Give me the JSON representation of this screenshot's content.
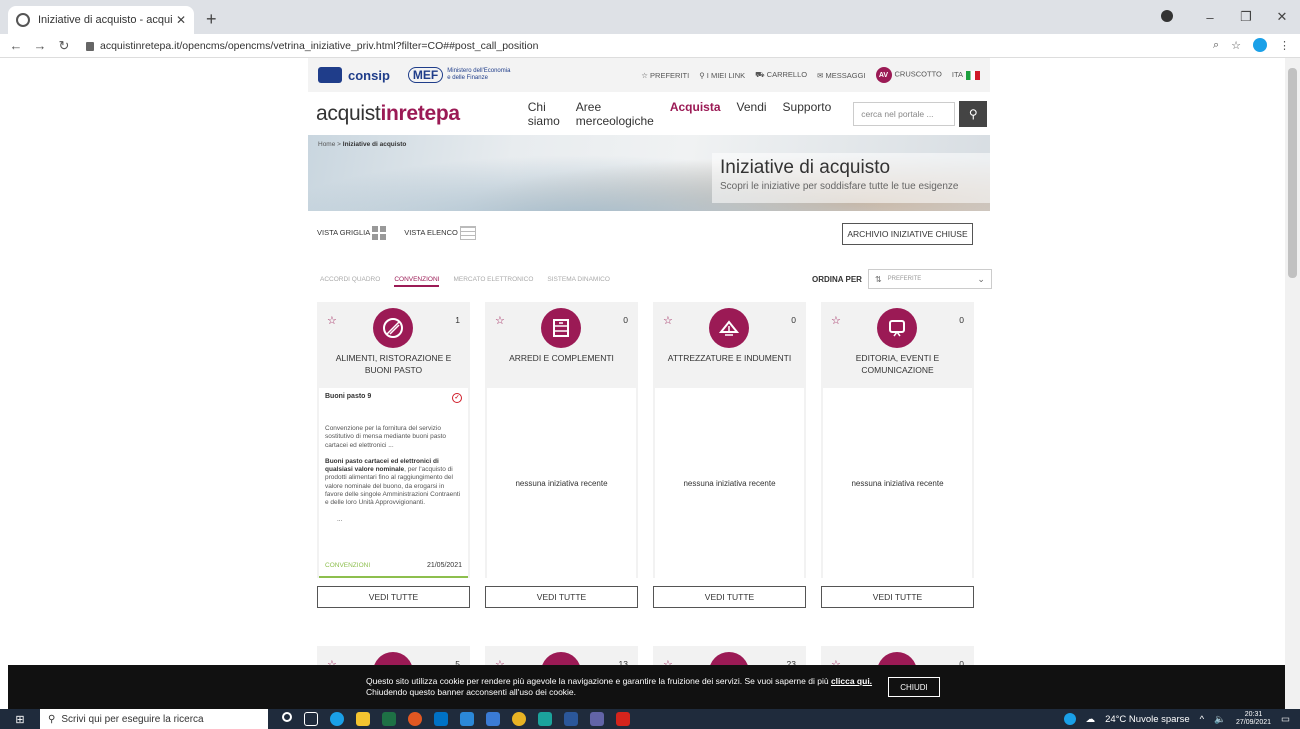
{
  "browser": {
    "tab_title": "Iniziative di acquisto - acquistinr",
    "tab_close": "✕",
    "new_tab": "+",
    "url": "acquistinretepa.it/opencms/opencms/vetrina_iniziative_priv.html?filter=CO##post_call_position",
    "window_min": "–",
    "window_max": "❐",
    "window_close": "✕"
  },
  "topstrip": {
    "consip": "consip",
    "mef": "MEF",
    "mef_sub": "Ministero dell'Economia e delle Finanze",
    "links": [
      "PREFERITI",
      "I MIEI LINK",
      "CARRELLO",
      "MESSAGGI"
    ],
    "avatar": "AV",
    "cruscotto": "CRUSCOTTO",
    "lang": "ITA"
  },
  "header": {
    "brand_a": "acquist",
    "brand_b": "inrete",
    "brand_c": "pa",
    "nav": [
      "Chi siamo",
      "Aree merceologiche",
      "Acquista",
      "Vendi",
      "Supporto"
    ],
    "search_placeholder": "cerca nel portale ..."
  },
  "hero": {
    "breadcrumb_home": "Home",
    "breadcrumb_sep": ">",
    "breadcrumb_current": "Iniziative di acquisto",
    "title": "Iniziative di acquisto",
    "subtitle": "Scopri le iniziative per soddisfare tutte le tue esigenze"
  },
  "views": {
    "grid": "VISTA GRIGLIA",
    "list": "VISTA ELENCO",
    "archive": "ARCHIVIO INIZIATIVE CHIUSE"
  },
  "filters": [
    "ACCORDI QUADRO",
    "CONVENZIONI",
    "MERCATO ELETTRONICO",
    "SISTEMA DINAMICO"
  ],
  "order": {
    "label": "ORDINA PER",
    "selected": "PREFERITE"
  },
  "cards": [
    {
      "name": "ALIMENTI, RISTORAZIONE E BUONI PASTO",
      "count": "1"
    },
    {
      "name": "ARREDI E COMPLEMENTI",
      "count": "0",
      "empty": "nessuna iniziativa recente"
    },
    {
      "name": "ATTREZZATURE E INDUMENTI",
      "count": "0",
      "empty": "nessuna iniziativa recente"
    },
    {
      "name": "EDITORIA, EVENTI E COMUNICAZIONE",
      "count": "0",
      "empty": "nessuna iniziativa recente"
    }
  ],
  "featured": {
    "title": "Buoni pasto 9",
    "desc": "Convenzione per la fornitura del servizio sostitutivo di mensa mediante buoni pasto cartacei ed elettronici ...",
    "detail_bold": "Buoni pasto cartacei ed elettronici di qualsiasi valore nominale",
    "detail_rest": ", per l'acquisto di prodotti alimentari fino al raggiungimento del valore nominale del buono, da erogarsi in favore delle singole Amministrazioni Contraenti e delle loro Unità Approvvigionanti.",
    "ellipsis": "...",
    "tag": "CONVENZIONI",
    "date": "21/05/2021"
  },
  "vedi_tutte": "VEDI TUTTE",
  "row2_counts": [
    "5",
    "13",
    "23",
    "0"
  ],
  "cookie": {
    "text": "Questo sito utilizza cookie per rendere più agevole la navigazione e garantire la fruizione dei servizi. Se vuoi saperne di più ",
    "link": "clicca qui.",
    "text2": "Chiudendo questo banner acconsenti all'uso dei cookie.",
    "close": "CHIUDI"
  },
  "taskbar": {
    "search": "Scrivi qui per eseguire la ricerca",
    "weather": "24°C  Nuvole sparse",
    "time": "20:31",
    "date": "27/09/2021"
  },
  "colors": {
    "brand": "#9b1a55",
    "accent_green": "#8dbf4d"
  }
}
